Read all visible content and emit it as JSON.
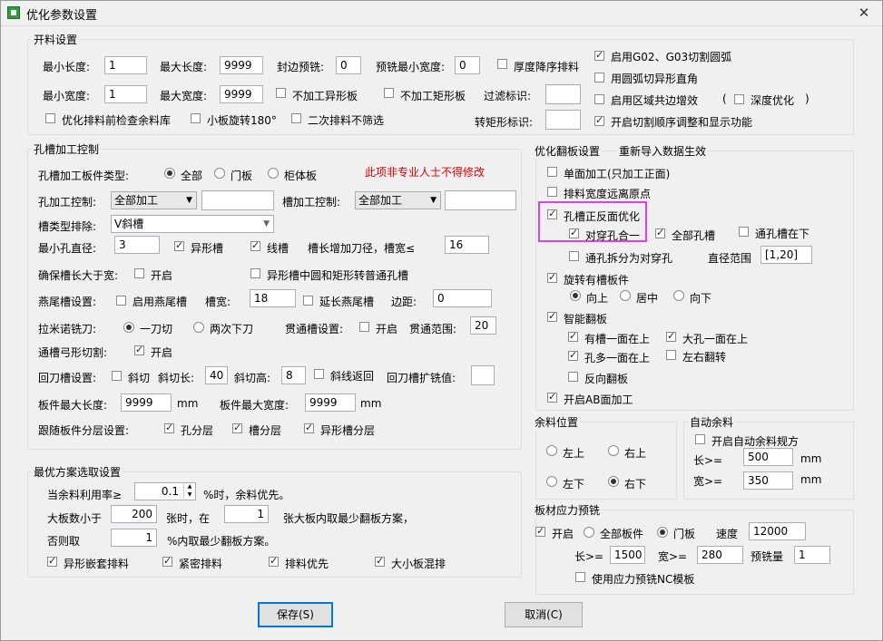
{
  "window": {
    "title": "优化参数设置"
  },
  "cutting": {
    "title": "开料设置",
    "min_len_label": "最小长度:",
    "min_len": "1",
    "max_len_label": "最大长度:",
    "max_len": "9999",
    "edge_mill_label": "封边预铣:",
    "edge_mill": "0",
    "premill_min_width_label": "预铣最小宽度:",
    "premill_min_width": "0",
    "thickness_desc_label": "厚度降序排料",
    "min_width_label": "最小宽度:",
    "min_width": "1",
    "max_width_label": "最大宽度:",
    "max_width": "9999",
    "no_shaped_label": "不加工异形板",
    "no_rect_label": "不加工矩形板",
    "filter_label": "过滤标识:",
    "filter_value": "",
    "check_remnant_label": "优化排料前检查余料库",
    "small_rotate_label": "小板旋转180°",
    "no_filter_second_label": "二次排料不筛选",
    "rect_convert_label": "转矩形标识:",
    "rect_convert_value": "",
    "g02_label": "启用G02、G03切割圆弧",
    "arc_corner_label": "用圆弧切异形直角",
    "region_common_label": "启用区域共边增效",
    "paren_open": "(",
    "deep_opt_label": "深度优化",
    "paren_close": ")",
    "cut_order_label": "开启切割顺序调整和显示功能"
  },
  "hole": {
    "title": "孔槽加工控制",
    "part_type_label": "孔槽加工板件类型:",
    "type_all": "全部",
    "type_door": "门板",
    "type_cabinet": "柜体板",
    "warning": "此项非专业人士不得修改",
    "hole_ctrl_label": "孔加工控制:",
    "hole_ctrl_value": "全部加工",
    "slot_ctrl_label": "槽加工控制:",
    "slot_ctrl_value": "全部加工",
    "slot_exclude_label": "槽类型排除:",
    "slot_exclude_value": "V斜槽",
    "min_hole_label": "最小孔直径:",
    "min_hole": "3",
    "shaped_slot_label": "异形槽",
    "line_slot_label": "线槽",
    "slot_len_label": "槽长增加刀径，槽宽≤",
    "slot_len": "16",
    "ensure_len_label": "确保槽长大于宽:",
    "open_label": "开启",
    "shaped_to_normal_label": "异形槽中圆和矩形转普通孔槽",
    "dovetail_label": "燕尾槽设置:",
    "enable_dovetail_label": "启用燕尾槽",
    "slot_width_label": "槽宽:",
    "slot_width": "18",
    "extend_dovetail_label": "延长燕尾槽",
    "margin_label": "边距:",
    "margin": "0",
    "lamino_label": "拉米诺铣刀:",
    "one_cut_label": "一刀切",
    "two_cut_label": "两次下刀",
    "through_label": "贯通槽设置:",
    "through_range_label": "贯通范围:",
    "through_range": "20",
    "arc_cut_label": "通槽弓形切割:",
    "return_label": "回刀槽设置:",
    "bevel_label": "斜切",
    "bevel_len_label": "斜切长:",
    "bevel_len": "40",
    "bevel_h_label": "斜切高:",
    "bevel_h": "8",
    "bevel_return_label": "斜线返回",
    "return_expand_label": "回刀槽扩铣值:",
    "return_expand": "",
    "part_max_len_label": "板件最大长度:",
    "part_max_len": "9999",
    "mm1": "mm",
    "part_max_w_label": "板件最大宽度:",
    "part_max_w": "9999",
    "mm2": "mm",
    "layer_label": "跟随板件分层设置:",
    "hole_layer_label": "孔分层",
    "slot_layer_label": "槽分层",
    "shaped_layer_label": "异形槽分层"
  },
  "best": {
    "title": "最优方案选取设置",
    "rate_label": "当余料利用率≥",
    "rate": "0.1",
    "rate_suffix": "%时，余料优先。",
    "count_label": "大板数小于",
    "count": "200",
    "count_mid": "张时，在",
    "count_val2": "1",
    "count_suffix": "张大板内取最少翻板方案，",
    "else_label": "否则取",
    "else_val": "1",
    "else_suffix": "%内取最少翻板方案。",
    "shaped_nest_label": "异形嵌套排料",
    "tight_label": "紧密排料",
    "priority_label": "排料优先",
    "mix_label": "大小板混排"
  },
  "flip": {
    "title": "优化翻板设置",
    "reimport_label": "重新导入数据生效",
    "single_label": "单面加工(只加工正面)",
    "width_far_label": "排料宽度远离原点",
    "both_sides_label": "孔槽正反面优化",
    "through_merge_label": "对穿孔合一",
    "all_slot_label": "全部孔槽",
    "slot_down_label": "通孔槽在下",
    "split_through_label": "通孔拆分为对穿孔",
    "diam_range_label": "直径范围",
    "diam_range": "[1,20]",
    "rotate_label": "旋转有槽板件",
    "up_label": "向上",
    "center_label": "居中",
    "down_label": "向下",
    "smart_label": "智能翻板",
    "slot_side_up_label": "有槽一面在上",
    "big_hole_up_label": "大孔一面在上",
    "more_hole_up_label": "孔多一面在上",
    "lr_flip_label": "左右翻转",
    "reverse_label": "反向翻板",
    "ab_label": "开启AB面加工"
  },
  "remnant": {
    "title": "余料位置",
    "tl": "左上",
    "tr": "右上",
    "bl": "左下",
    "br": "右下"
  },
  "auto_remnant": {
    "title": "自动余料",
    "enable_label": "开启自动余料规方",
    "len_label": "长>=",
    "len": "500",
    "mm_a": "mm",
    "width_label": "宽>=",
    "width": "350",
    "mm_b": "mm"
  },
  "stress": {
    "title": "板材应力预铣",
    "open_label": "开启",
    "all_label": "全部板件",
    "door_label": "门板",
    "speed_label": "速度",
    "speed": "12000",
    "len_label": "长>=",
    "len": "1500",
    "width_label": "宽>=",
    "width": "280",
    "amount_label": "预铣量",
    "amount": "1",
    "nc_label": "使用应力预铣NC模板"
  },
  "buttons": {
    "save": "保存(S)",
    "cancel": "取消(C)"
  }
}
